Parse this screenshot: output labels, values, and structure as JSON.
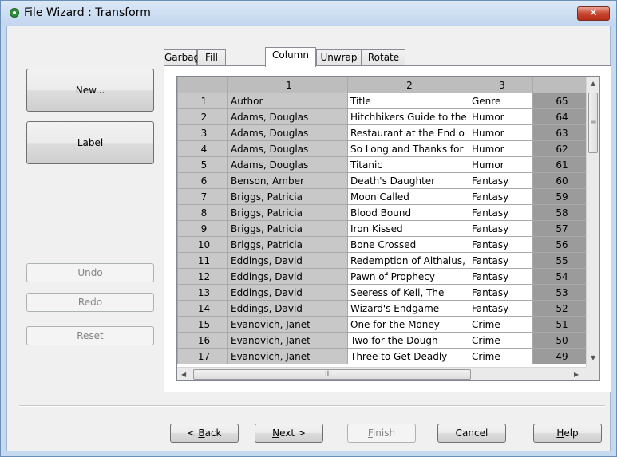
{
  "window": {
    "title": "File Wizard : Transform",
    "close_glyph": "✕"
  },
  "left_buttons": {
    "new": "New...",
    "label": "Label",
    "undo": "Undo",
    "redo": "Redo",
    "reset": "Reset"
  },
  "tabs": [
    "Garbage",
    "Fill",
    "Column",
    "Unwrap",
    "Rotate"
  ],
  "active_tab": "Column",
  "grid": {
    "col_headers": [
      "1",
      "2",
      "3"
    ],
    "rows": [
      {
        "n": "1",
        "c1": "Author",
        "c2": "Title",
        "c3": "Genre",
        "c4": "65"
      },
      {
        "n": "2",
        "c1": "Adams, Douglas",
        "c2": "Hitchhikers Guide to the",
        "c3": "Humor",
        "c4": "64"
      },
      {
        "n": "3",
        "c1": "Adams, Douglas",
        "c2": "Restaurant at the End o",
        "c3": "Humor",
        "c4": "63"
      },
      {
        "n": "4",
        "c1": "Adams, Douglas",
        "c2": "So Long and Thanks for",
        "c3": "Humor",
        "c4": "62"
      },
      {
        "n": "5",
        "c1": "Adams, Douglas",
        "c2": "Titanic",
        "c3": "Humor",
        "c4": "61"
      },
      {
        "n": "6",
        "c1": "Benson, Amber",
        "c2": "Death's Daughter",
        "c3": "Fantasy",
        "c4": "60"
      },
      {
        "n": "7",
        "c1": "Briggs, Patricia",
        "c2": "Moon Called",
        "c3": "Fantasy",
        "c4": "59"
      },
      {
        "n": "8",
        "c1": "Briggs, Patricia",
        "c2": "Blood Bound",
        "c3": "Fantasy",
        "c4": "58"
      },
      {
        "n": "9",
        "c1": "Briggs, Patricia",
        "c2": "Iron Kissed",
        "c3": "Fantasy",
        "c4": "57"
      },
      {
        "n": "10",
        "c1": "Briggs, Patricia",
        "c2": "Bone Crossed",
        "c3": "Fantasy",
        "c4": "56"
      },
      {
        "n": "11",
        "c1": "Eddings, David",
        "c2": "Redemption of Althalus,",
        "c3": "Fantasy",
        "c4": "55"
      },
      {
        "n": "12",
        "c1": "Eddings, David",
        "c2": "Pawn of Prophecy",
        "c3": "Fantasy",
        "c4": "54"
      },
      {
        "n": "13",
        "c1": "Eddings, David",
        "c2": "Seeress of Kell, The",
        "c3": "Fantasy",
        "c4": "53"
      },
      {
        "n": "14",
        "c1": "Eddings, David",
        "c2": "Wizard's Endgame",
        "c3": "Fantasy",
        "c4": "52"
      },
      {
        "n": "15",
        "c1": "Evanovich, Janet",
        "c2": "One for the Money",
        "c3": "Crime",
        "c4": "51"
      },
      {
        "n": "16",
        "c1": "Evanovich, Janet",
        "c2": "Two for the Dough",
        "c3": "Crime",
        "c4": "50"
      },
      {
        "n": "17",
        "c1": "Evanovich, Janet",
        "c2": "Three to Get Deadly",
        "c3": "Crime",
        "c4": "49"
      }
    ]
  },
  "footer": {
    "back": {
      "accel": "B",
      "rest": "ack",
      "prefix": "< "
    },
    "next": {
      "accel": "N",
      "rest": "ext >"
    },
    "finish": {
      "accel": "F",
      "rest": "inish"
    },
    "cancel": "Cancel",
    "help": {
      "accel": "H",
      "rest": "elp"
    }
  },
  "scroll_glyphs": {
    "up": "▲",
    "down": "▼",
    "left": "◀",
    "right": "▶",
    "vgrip": "≡",
    "hgrip": "III"
  }
}
